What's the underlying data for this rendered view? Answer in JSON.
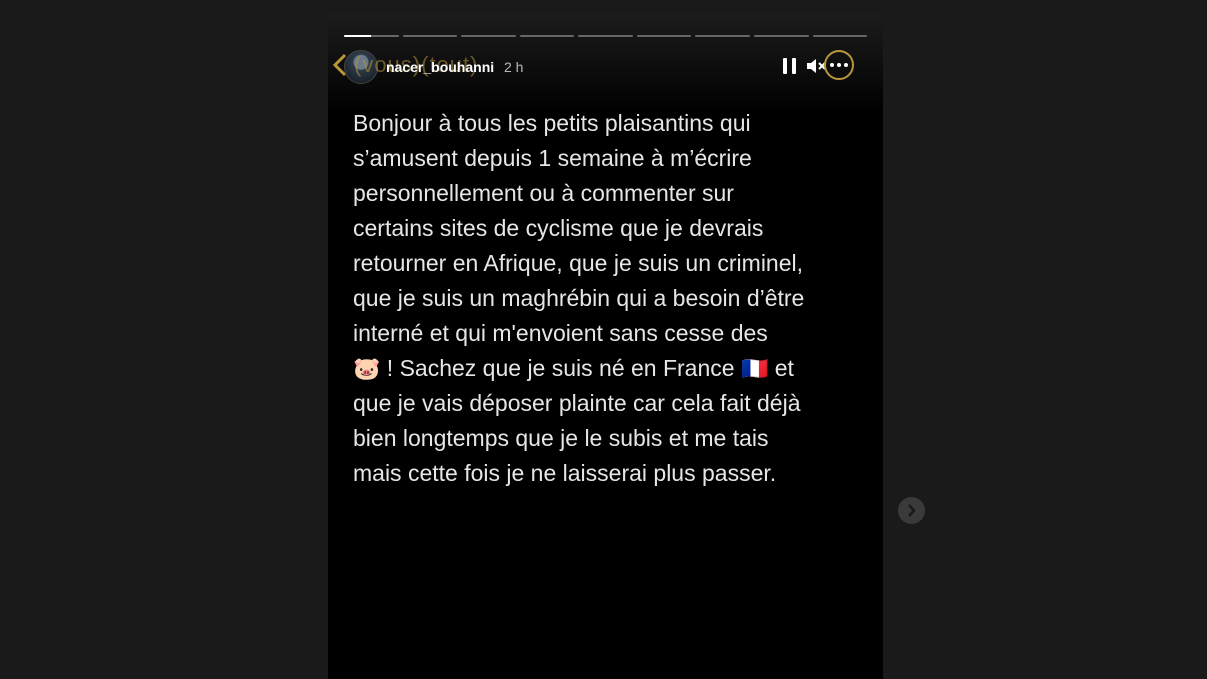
{
  "story": {
    "progress": {
      "segments": 9,
      "active_index": 0,
      "active_fill_percent": 50
    },
    "overlay_text": "(vous)(tout)",
    "user": {
      "username": "nacer_bouhanni",
      "time_ago": "2 h"
    },
    "text_lines": [
      "Bonjour à tous les petits plaisantins qui",
      "s’amusent depuis 1 semaine à m’écrire",
      "personnellement ou à commenter sur",
      "certains sites de cyclisme que je devrais",
      "retourner en Afrique, que je suis un criminel,",
      "que je suis un maghrébin qui a besoin d’être",
      "interné et qui m'envoient sans cesse des"
    ],
    "line8": {
      "pig": "🐷",
      "middle": " ! Sachez que je suis né en France ",
      "flag": "🇫🇷",
      "end": " et"
    },
    "text_lines_end": [
      "que je vais déposer plainte car cela fait déjà",
      "bien longtemps que je le subis et me tais",
      "mais cette fois je ne laisserai plus passer."
    ]
  },
  "icons": {
    "back": "chevron-left-icon",
    "pause": "pause-icon",
    "mute": "speaker-muted-icon",
    "more": "more-horizontal-icon",
    "next": "chevron-right-icon"
  },
  "colors": {
    "page_bg": "#1a1a1a",
    "story_bg": "#000000",
    "accent_overlay": "#b8963a",
    "text": "#e6e6e6"
  }
}
